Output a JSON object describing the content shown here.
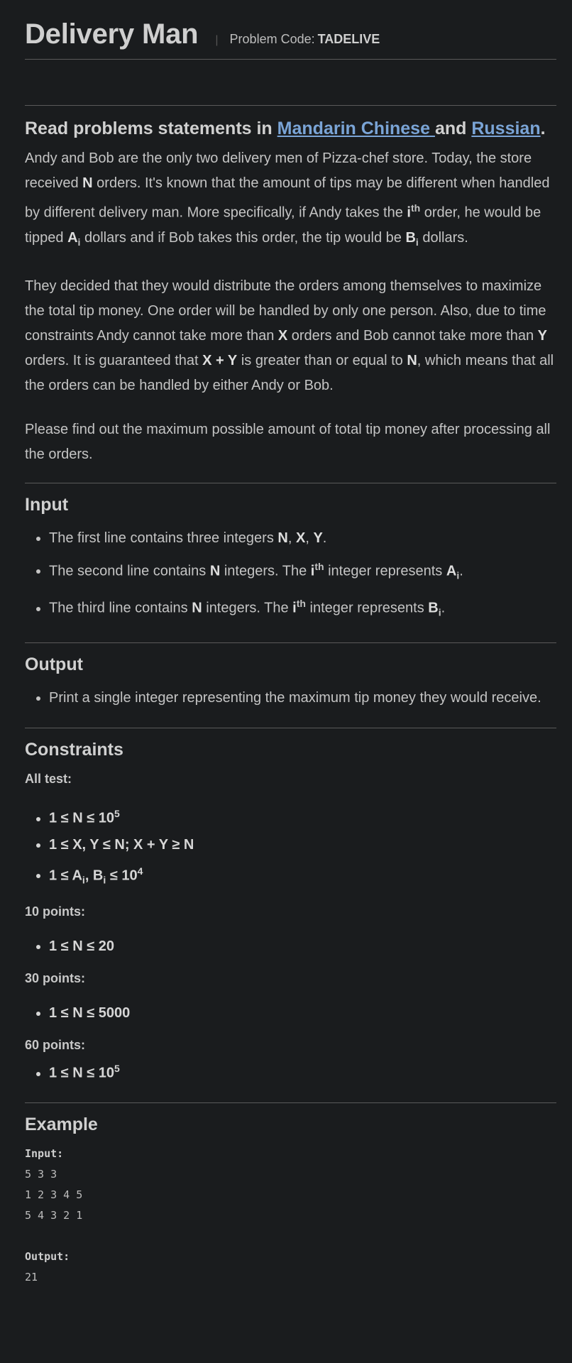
{
  "header": {
    "title": "Delivery Man",
    "code_label": "Problem Code:",
    "code_value": "TADELIVE"
  },
  "read": {
    "prefix": "Read problems statements in",
    "link1": "Mandarin Chinese ",
    "middle": "and",
    "link2": "Russian",
    "suffix": "."
  },
  "statement": {
    "p1": {
      "t1": "Andy and Bob are the only two delivery men of Pizza-chef store. Today, the store received ",
      "n": "N",
      "t2": " orders. It's known that the amount of tips may be different when handled by different delivery man. More specifically, if Andy takes the ",
      "i": "i",
      "th": "th",
      "t3": " order, he would be tipped ",
      "a": "A",
      "ai": "i",
      "t4": " dollars and if Bob takes this order, the tip would be ",
      "b": "B",
      "bi": "i",
      "t5": " dollars."
    },
    "p2": {
      "t1": "They decided that they would distribute the orders among themselves to maximize the total tip money. One order will be handled by only one person. Also, due to time constraints Andy cannot take more than ",
      "x": "X",
      "t2": " orders and Bob cannot take more than ",
      "y": "Y",
      "t3": " orders. It is guaranteed that ",
      "xy": "X + Y",
      "t4": " is greater than or equal to ",
      "n": "N",
      "t5": ", which means that all the orders can be handled by either Andy or Bob."
    },
    "p3": "Please find out the maximum possible amount of total tip money after processing all the orders."
  },
  "input": {
    "heading": "Input",
    "l1": {
      "t1": "The first line contains three integers ",
      "vars": "N",
      "c1": ", ",
      "x": "X",
      "c2": ", ",
      "y": "Y",
      "t2": "."
    },
    "l2": {
      "t1": "The second line contains ",
      "n": "N",
      "t2": " integers. The ",
      "i": "i",
      "th": "th",
      "t3": " integer represents ",
      "a": "A",
      "ai": "i",
      "t4": "."
    },
    "l3": {
      "t1": "The third line contains ",
      "n": "N",
      "t2": " integers. The ",
      "i": "i",
      "th": "th",
      "t3": " integer represents ",
      "b": "B",
      "bi": "i",
      "t4": "."
    }
  },
  "output": {
    "heading": "Output",
    "l1": "Print a single integer representing the maximum tip money they would receive."
  },
  "constraints": {
    "heading": "Constraints",
    "all_test": "All test:",
    "c1": {
      "t": "1 ≤ N ≤ 10",
      "sup": "5"
    },
    "c2": "1 ≤ X, Y ≤ N; X + Y ≥ N",
    "c3": {
      "t1": "1 ≤ A",
      "s1": "i",
      "t2": ", B",
      "s2": "i",
      "t3": " ≤ 10",
      "sup": "4"
    },
    "p10": "10 points:",
    "p10_c": "1 ≤ N ≤ 20",
    "p30": "30 points:",
    "p30_c": "1 ≤ N ≤ 5000",
    "p60": "60 points:",
    "p60_c": {
      "t": "1 ≤ N ≤ 10",
      "sup": "5"
    }
  },
  "example": {
    "heading": "Example",
    "input_label": "Input:",
    "input_lines": [
      "5 3 3",
      "1 2 3 4 5",
      "5 4 3 2 1"
    ],
    "output_label": "Output:",
    "output_value": "21"
  }
}
